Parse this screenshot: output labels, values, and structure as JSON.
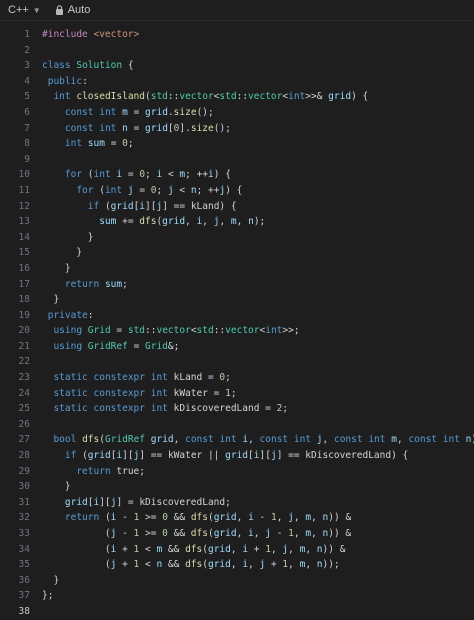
{
  "toolbar": {
    "language": "C++",
    "mode": "Auto"
  },
  "colors": {
    "background": "#1e1e1e",
    "keyword": "#569cd6",
    "type": "#4ec9b0",
    "function": "#dcdcaa",
    "number": "#b5cea8",
    "string": "#ce9178",
    "preprocessor": "#c586c0",
    "plain": "#d4d4d4"
  },
  "editor": {
    "lines": [
      "#include <vector>",
      "",
      "class Solution {",
      " public:",
      "  int closedIsland(std::vector<std::vector<int>>& grid) {",
      "    const int m = grid.size();",
      "    const int n = grid[0].size();",
      "    int sum = 0;",
      "",
      "    for (int i = 0; i < m; ++i) {",
      "      for (int j = 0; j < n; ++j) {",
      "        if (grid[i][j] == kLand) {",
      "          sum += dfs(grid, i, j, m, n);",
      "        }",
      "      }",
      "    }",
      "    return sum;",
      "  }",
      " private:",
      "  using Grid = std::vector<std::vector<int>>;",
      "  using GridRef = Grid&;",
      "",
      "  static constexpr int kLand = 0;",
      "  static constexpr int kWater = 1;",
      "  static constexpr int kDiscoveredLand = 2;",
      "",
      "  bool dfs(GridRef grid, const int i, const int j, const int m, const int n) {",
      "    if (grid[i][j] == kWater || grid[i][j] == kDiscoveredLand) {",
      "      return true;",
      "    }",
      "    grid[i][j] = kDiscoveredLand;",
      "    return (i - 1 >= 0 && dfs(grid, i - 1, j, m, n)) &",
      "           (j - 1 >= 0 && dfs(grid, i, j - 1, m, n)) &",
      "           (i + 1 < m && dfs(grid, i + 1, j, m, n)) &",
      "           (j + 1 < n && dfs(grid, i, j + 1, m, n));",
      "  }",
      "};",
      ""
    ]
  }
}
